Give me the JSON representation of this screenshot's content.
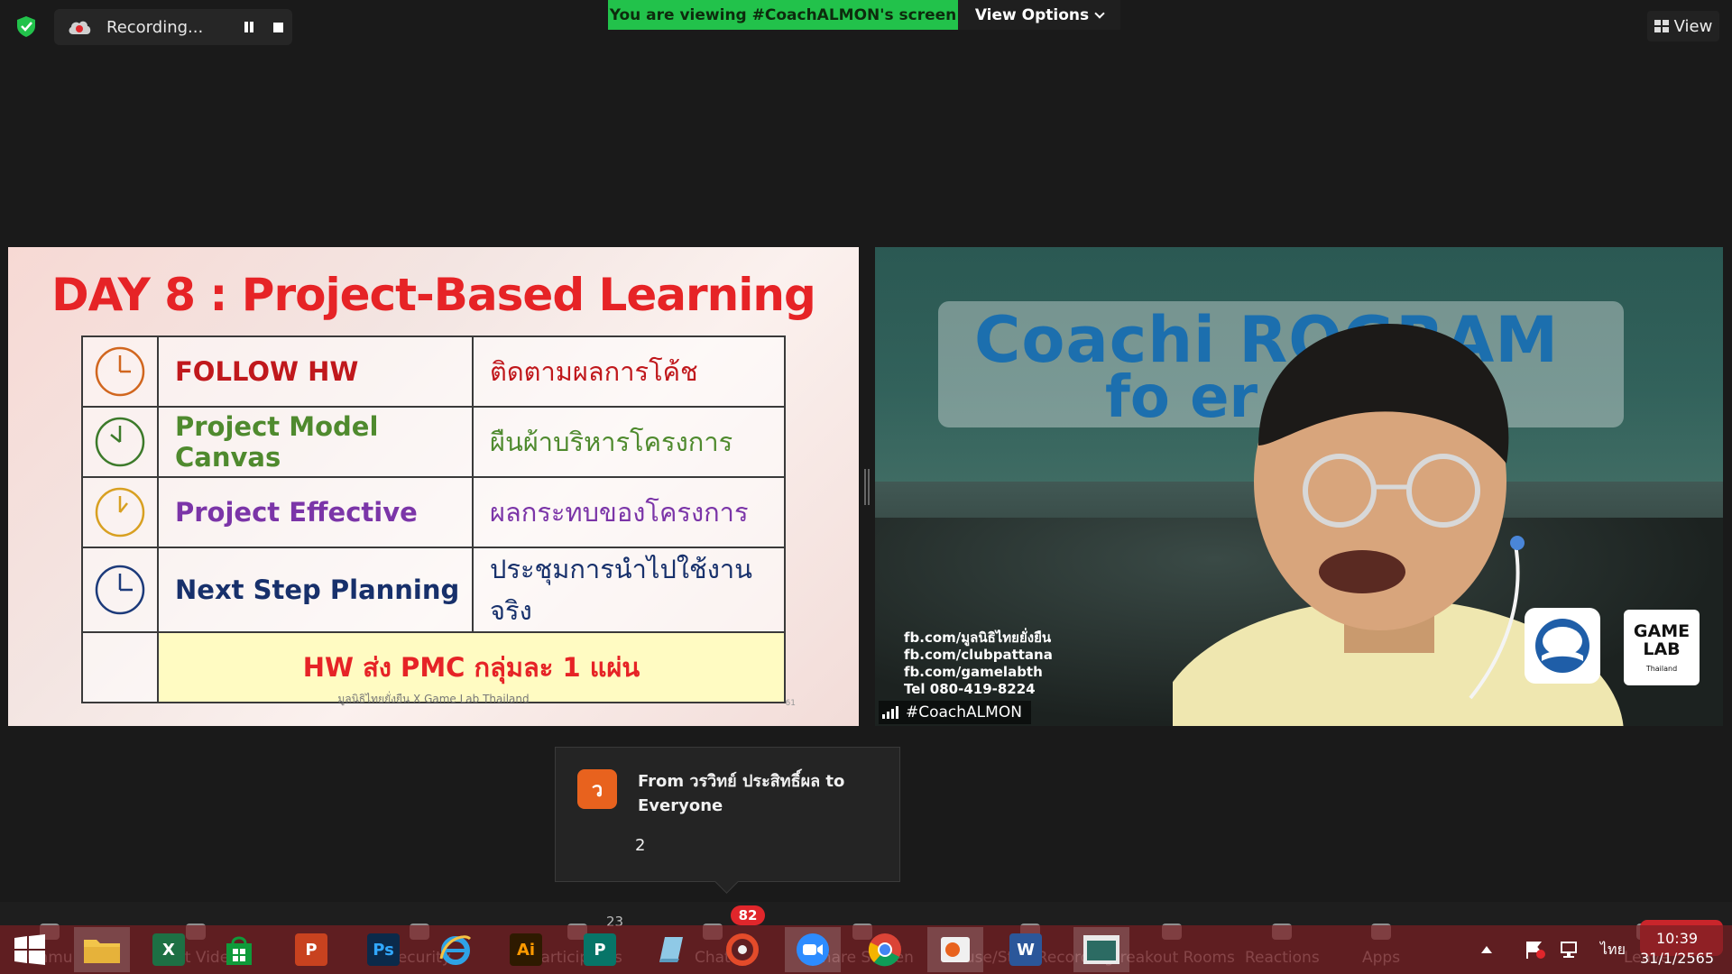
{
  "top_bar": {
    "recording_label": "Recording...",
    "viewing_banner": "You are viewing #CoachALMON's screen",
    "view_options_label": "View Options",
    "view_label": "View"
  },
  "slide": {
    "title": "DAY 8 : Project-Based Learning",
    "rows": [
      {
        "en": "FOLLOW HW",
        "th": "ติดตามผลการโค้ช",
        "color": "#c0181c",
        "th_color": "#c0181c",
        "clock_color": "#d1661e"
      },
      {
        "en": "Project Model Canvas",
        "th": "ผืนผ้าบริหารโครงการ",
        "color": "#4f8a2e",
        "th_color": "#4f8a2e",
        "clock_color": "#3c7a2a"
      },
      {
        "en": "Project Effective",
        "th": "ผลกระทบของโครงการ",
        "color": "#7b35a8",
        "th_color": "#7b35a8",
        "clock_color": "#d8a021"
      },
      {
        "en": "Next Step Planning",
        "th": "ประชุมการนำไปใช้งานจริง",
        "color": "#17306b",
        "th_color": "#17306b",
        "clock_color": "#1c3a7a"
      }
    ],
    "hw_note": "HW ส่ง PMC กลุ่มละ 1 แผ่น",
    "footer": "มูลนิธิไทยยั่งยืน X Game Lab Thailand",
    "page_num": "61"
  },
  "video": {
    "headline_line1": "Coachi      ROGRAM",
    "headline_line2": "fo         er",
    "contacts": [
      "fb.com/มูลนิธิไทยยั่งยืน",
      "fb.com/clubpattana",
      "fb.com/gamelabth",
      "Tel 080-419-8224"
    ],
    "logo_game_line1": "GAME",
    "logo_game_line2": "LAB",
    "logo_game_sub": "Thailand",
    "participant_name": "#CoachALMON"
  },
  "chat_notification": {
    "avatar_letter": "ว",
    "from_text": "From วรวิทย์ ประสิทธิ์ผล to Everyone",
    "message": "2"
  },
  "zoom_toolbar": {
    "items": [
      {
        "label": "Unmu",
        "icon": "mic-muted-icon"
      },
      {
        "label": "Start Video",
        "icon": "video-off-icon"
      },
      {
        "label": "Security",
        "icon": "shield-icon"
      },
      {
        "label": "Participants",
        "icon": "participants-icon"
      },
      {
        "label": "Chat",
        "icon": "chat-icon"
      },
      {
        "label": "Share Screen",
        "icon": "share-icon"
      },
      {
        "label": "Pause/Stop Recording",
        "icon": "recording-icon"
      },
      {
        "label": "Breakout Rooms",
        "icon": "breakout-icon"
      },
      {
        "label": "Reactions",
        "icon": "reactions-icon"
      },
      {
        "label": "Apps",
        "icon": "apps-icon"
      },
      {
        "label": "Leave",
        "icon": "leave-icon"
      }
    ],
    "participants_count": "23",
    "chat_badge": "82"
  },
  "taskbar": {
    "excel_label": "X",
    "store_label": "",
    "powerpoint_label": "P",
    "photoshop_label": "Ps",
    "illustrator_label": "Ai",
    "publisher_label": "P",
    "word_label": "W",
    "tray_language": "ไทย",
    "time": "10:39",
    "date": "31/1/2565"
  },
  "colors": {
    "banner_green": "#22c24b",
    "slide_red": "#e62326",
    "leave_red": "#c9252b"
  }
}
